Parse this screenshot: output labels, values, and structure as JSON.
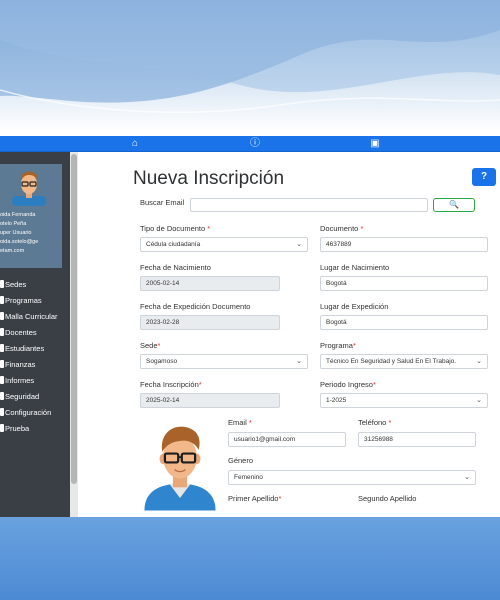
{
  "topbar": {
    "icons": [
      "home-icon",
      "info-icon",
      "calendar-icon"
    ],
    "glyphs": [
      "⌂",
      "ⓘ",
      "▣"
    ]
  },
  "profile": {
    "lines": [
      "oida Fernanda",
      "otelo Peña",
      "uper Usuario",
      "oida.sotelo@ge",
      "etam.com"
    ]
  },
  "menu": {
    "items": [
      "Sedes",
      "Programas",
      "Malla Curricular",
      "Docentes",
      "Estudiantes",
      "Finanzas",
      "Informes",
      "Seguridad",
      "Configuración",
      "Prueba"
    ]
  },
  "page": {
    "title": "Nueva Inscripción",
    "help": "?"
  },
  "form": {
    "search_label": "Buscar Email",
    "search_value": "",
    "search_button": "🔍",
    "tipo_documento_label": "Tipo de Documento",
    "tipo_documento_value": "Cédula ciudadanía",
    "documento_label": "Documento",
    "documento_value": "4637889",
    "fecha_nacimiento_label": "Fecha de Nacimiento",
    "fecha_nacimiento_value": "2005-02-14",
    "lugar_nacimiento_label": "Lugar de Nacimiento",
    "lugar_nacimiento_value": "Bogotá",
    "fecha_expedicion_label": "Fecha de Expedición Documento",
    "fecha_expedicion_value": "2023-02-28",
    "lugar_expedicion_label": "Lugar de Expedición",
    "lugar_expedicion_value": "Bogotá",
    "sede_label": "Sede",
    "sede_value": "Sogamoso",
    "programa_label": "Programa",
    "programa_value": "Técnico En Seguridad y Salud En El Trabajo.",
    "fecha_inscripcion_label": "Fecha Inscripción",
    "fecha_inscripcion_value": "2025-02-14",
    "periodo_label": "Periodo Ingreso",
    "periodo_value": "1-2025",
    "email_label": "Email",
    "email_value": "usuario1@gmail.com",
    "telefono_label": "Teléfono",
    "telefono_value": "31256988",
    "genero_label": "Género",
    "genero_value": "Femenino",
    "primer_apellido_label": "Primer Apellido",
    "segundo_apellido_label": "Segundo Apellido",
    "required_mark": "*"
  },
  "colors": {
    "accent": "#1a73e8",
    "sidebar": "#3a3f46",
    "success": "#28a745"
  }
}
